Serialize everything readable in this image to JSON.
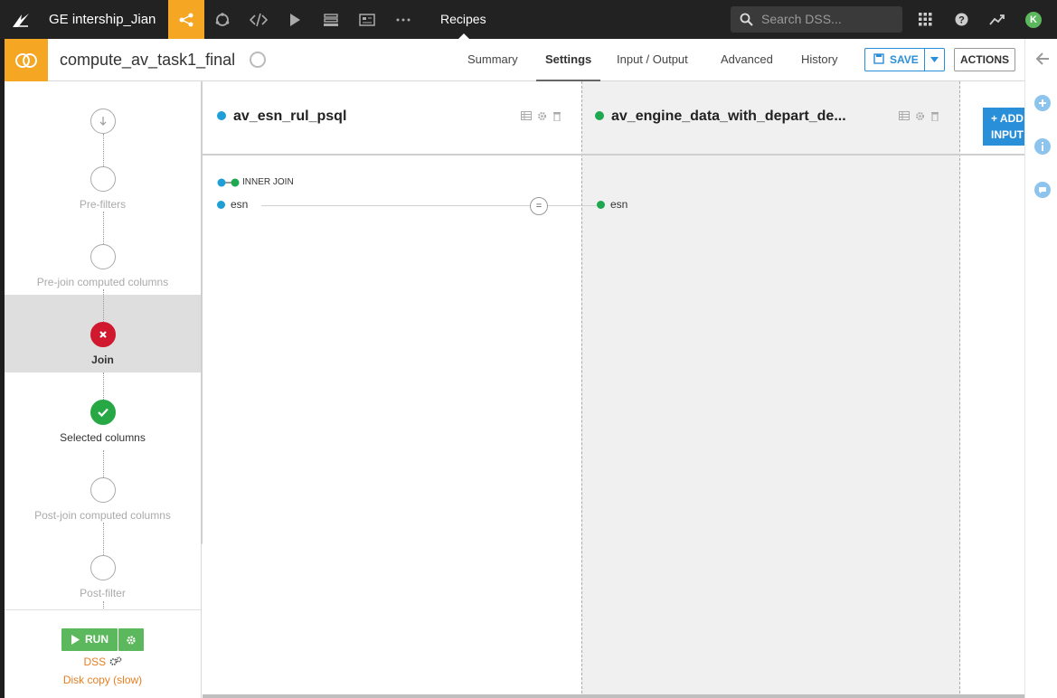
{
  "topbar": {
    "project_name": "GE intership_Jian",
    "section": "Recipes",
    "search_placeholder": "Search DSS...",
    "avatar_letter": "K",
    "icons": [
      "dataiku-logo-icon",
      "flow-icon",
      "jobs-icon",
      "code-icon",
      "run-icon",
      "stack-icon",
      "dashboard-icon",
      "more-icon",
      "apps-grid-icon",
      "help-icon",
      "activity-icon"
    ]
  },
  "recipe": {
    "title": "compute_av_task1_final",
    "tabs": [
      "Summary",
      "Settings",
      "Input / Output",
      "Advanced",
      "History"
    ],
    "active_tab": "Settings",
    "save_label": "SAVE",
    "actions_label": "ACTIONS"
  },
  "steps": [
    {
      "label": ""
    },
    {
      "label": "Pre-filters"
    },
    {
      "label": "Pre-join computed columns"
    },
    {
      "label": "Join",
      "status": "error"
    },
    {
      "label": "Selected columns",
      "status": "ok"
    },
    {
      "label": "Post-join computed columns"
    },
    {
      "label": "Post-filter"
    }
  ],
  "run": {
    "run_label": "RUN",
    "engine": "DSS",
    "engine_detail": "Disk copy (slow)"
  },
  "join": {
    "datasets": [
      {
        "name": "av_esn_rul_psql",
        "color": "#1e9fd6"
      },
      {
        "name": "av_engine_data_with_depart_de...",
        "color": "#1fa850"
      }
    ],
    "join_type": "INNER JOIN",
    "left_key": "esn",
    "operator": "=",
    "right_key": "esn",
    "add_input_line1": "+ ADD",
    "add_input_line2": "INPUT"
  },
  "colors": {
    "accent": "#f5a623",
    "blue": "#2a8fd9",
    "green": "#5cb85c",
    "error": "#d0192e"
  }
}
